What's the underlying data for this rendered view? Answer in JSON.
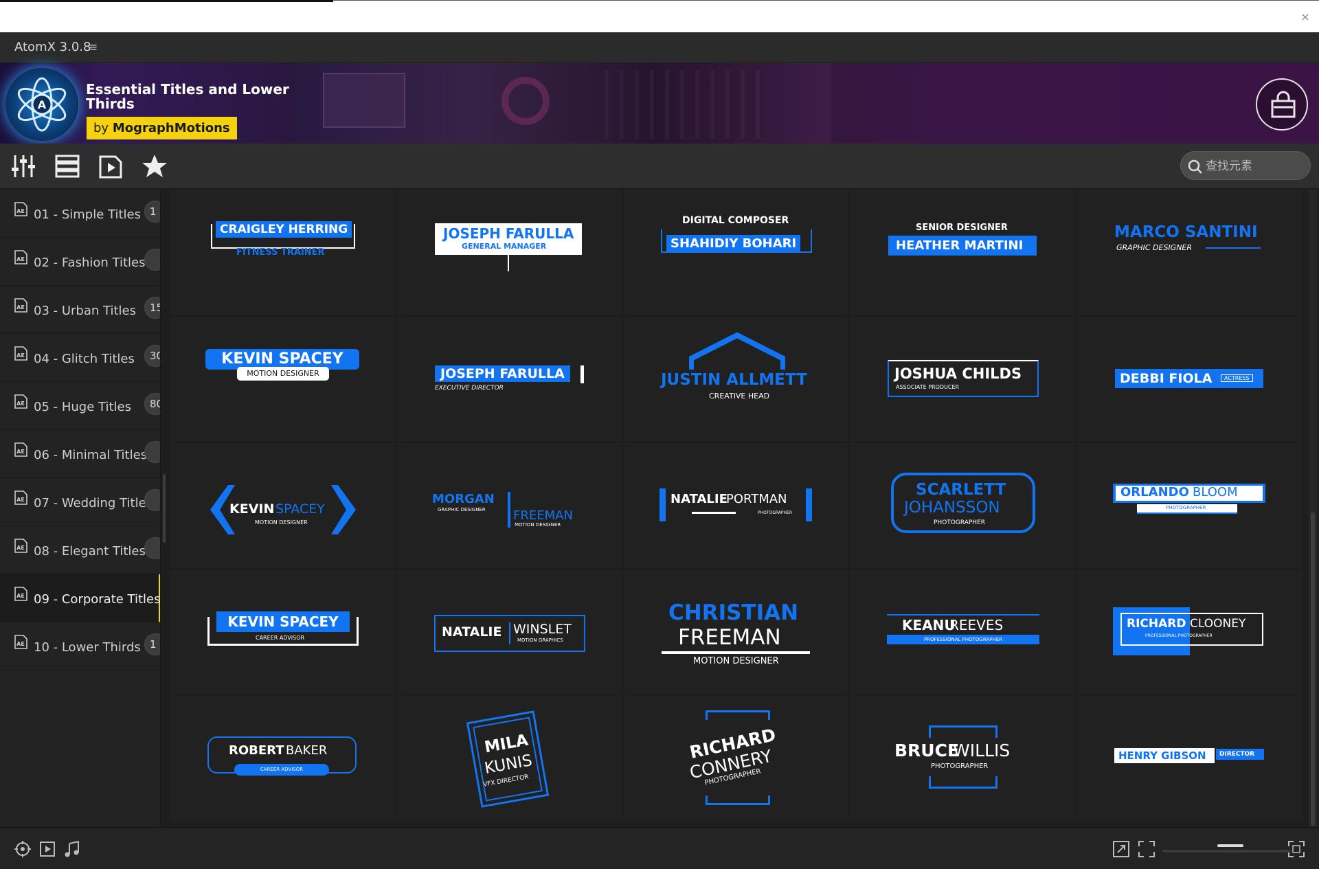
{
  "app": {
    "title": "AtomX 3.0.8"
  },
  "banner": {
    "title": "Essential Titles and Lower Thirds",
    "by": "by ",
    "author": "MographMotions"
  },
  "search": {
    "placeholder": "查找元素"
  },
  "sidebar": {
    "items": [
      {
        "label": "01 - Simple Titles",
        "count": "1"
      },
      {
        "label": "02 - Fashion Titles",
        "count": ""
      },
      {
        "label": "03 - Urban Titles",
        "count": "15"
      },
      {
        "label": "04 - Glitch Titles",
        "count": "30"
      },
      {
        "label": "05 - Huge Titles",
        "count": "80"
      },
      {
        "label": "06 - Minimal Titles",
        "count": ""
      },
      {
        "label": "07 - Wedding Titles",
        "count": ""
      },
      {
        "label": "08 - Elegant Titles",
        "count": ""
      },
      {
        "label": "09 - Corporate Titles",
        "count": ""
      },
      {
        "label": "10 - Lower Thirds",
        "count": "1"
      }
    ]
  },
  "cards": {
    "c1": {
      "a": "CRAIGLEY HERRING",
      "b": "FITNESS TRAINER"
    },
    "c2": {
      "a": "JOSEPH FARULLA",
      "b": "GENERAL MANAGER"
    },
    "c3": {
      "a": "DIGITAL COMPOSER",
      "b": "SHAHIDIY BOHARI"
    },
    "c4": {
      "a": "SENIOR DESIGNER",
      "b": "HEATHER MARTINI"
    },
    "c5": {
      "a": "MARCO SANTINI",
      "b": "GRAPHIC DESIGNER"
    },
    "c6": {
      "a": "KEVIN SPACEY",
      "b": "MOTION DESIGNER"
    },
    "c7": {
      "a": "JOSEPH FARULLA",
      "b": "EXECUTIVE DIRECTOR"
    },
    "c8": {
      "a": "JUSTIN ALLMETT",
      "b": "CREATIVE HEAD"
    },
    "c9": {
      "a": "JOSHUA CHILDS",
      "b": "ASSOCIATE PRODUCER"
    },
    "c10": {
      "a": "DEBBI FIOLA",
      "b": "ACTRESS"
    },
    "c11": {
      "a": "KEVIN",
      "b": "SPACEY",
      "c": "MOTION DESIGNER"
    },
    "c12": {
      "a": "MORGAN",
      "b": "GRAPHIC DESIGNER",
      "c": "FREEMAN",
      "d": "MOTION DESIGNER"
    },
    "c13": {
      "a": "NATALIE",
      "b": " PORTMAN",
      "c": "PHOTOGRAPHER"
    },
    "c14": {
      "a": "SCARLETT",
      "b": "JOHANSSON",
      "c": "PHOTOGRAPHER"
    },
    "c15": {
      "a": "ORLANDO",
      "b": " BLOOM",
      "c": "PHOTOGRAPHER"
    },
    "c16": {
      "a": "KEVIN SPACEY",
      "b": "CAREER ADVISOR"
    },
    "c17": {
      "a": "NATALIE",
      "b": "WINSLET",
      "c": "MOTION GRAPHICS"
    },
    "c18": {
      "a": "CHRISTIAN",
      "b": "FREEMAN",
      "c": "MOTION DESIGNER"
    },
    "c19": {
      "a": "KEANU",
      "b": " REEVES",
      "c": "PROFESSIONAL PHOTOGRAPHER"
    },
    "c20": {
      "a": "RICHARD",
      "b": " CLOONEY",
      "c": "PROFESSIONAL PHOTOGRAPHER"
    },
    "c21": {
      "a": "ROBERT",
      "b": " BAKER",
      "c": "CAREER ADVISOR"
    },
    "c22": {
      "a": "MILA",
      "b": "KUNIS",
      "c": "VFX DIRECTOR"
    },
    "c23": {
      "a": "RICHARD",
      "b": "CONNERY",
      "c": "PHOTOGRAPHER"
    },
    "c24": {
      "a": "BRUCE",
      "b": " WILLIS",
      "c": "PHOTOGRAPHER"
    },
    "c25": {
      "a": "HENRY GIBSON",
      "b": "DIRECTOR"
    }
  },
  "icons": {
    "toolbar": [
      "sliders-icon",
      "layout-icon",
      "preview-icon",
      "star-icon"
    ],
    "bottom": [
      "anchor-target-icon",
      "play-preview-icon",
      "music-icon",
      "resize-icon",
      "fullscreen-icon",
      "expand-icon"
    ]
  },
  "colors": {
    "accent": "#1374f2",
    "byline": "#f5d20f",
    "active_marker": "#e8d826"
  }
}
